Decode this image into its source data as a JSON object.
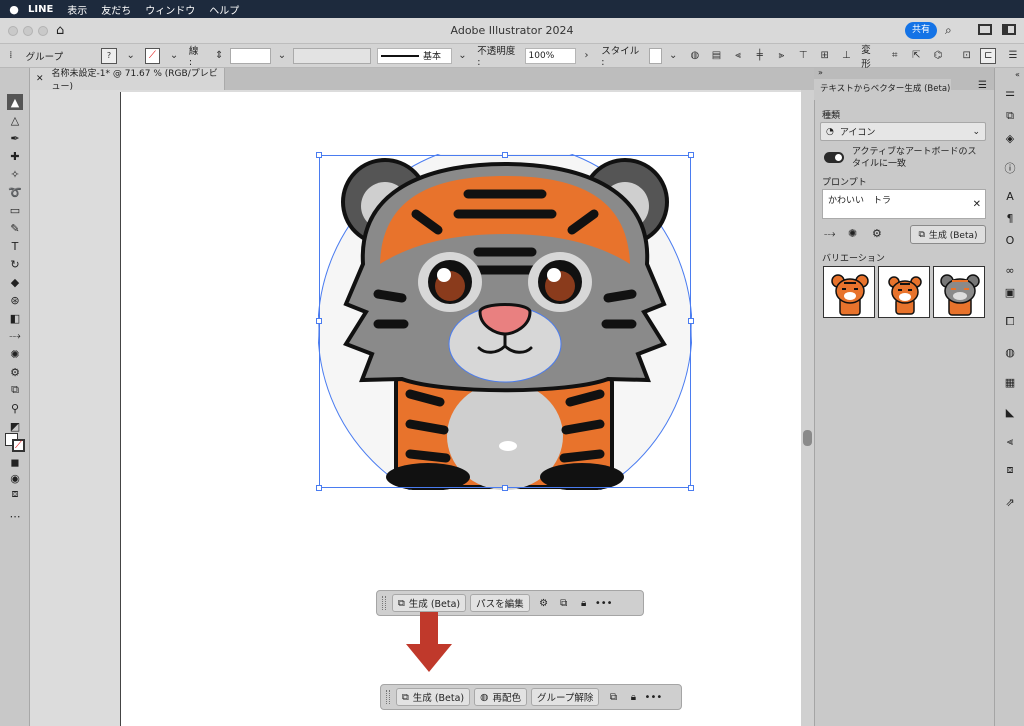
{
  "menubar": {
    "app": "LINE",
    "items": [
      "表示",
      "友だち",
      "ウィンドウ",
      "ヘルプ"
    ]
  },
  "window": {
    "title": "Adobe Illustrator 2024",
    "share_label": "共有"
  },
  "control_bar": {
    "selection_label": "グループ",
    "stroke_label": "線 :",
    "stroke_style": "基本",
    "opacity_label": "不透明度 :",
    "opacity_value": "100%",
    "style_label": "スタイル :",
    "transform_label": "変形"
  },
  "document_tab": {
    "label": "名称未設定-1* @ 71.67 % (RGB/プレビュー)"
  },
  "panel": {
    "tab_title": "テキストからベクター生成 (Beta)",
    "type_label": "種類",
    "type_value": "アイコン",
    "match_style_label_line1": "アクティブなアートボードのス",
    "match_style_label_line2": "タイルに一致",
    "prompt_label": "プロンプト",
    "prompt_value": "かわいい　トラ",
    "generate_label": "生成 (Beta)",
    "variations_label": "バリエーション"
  },
  "taskbar_top": {
    "generate_label": "生成 (Beta)",
    "edit_path_label": "パスを編集"
  },
  "taskbar_bottom": {
    "generate_label": "生成 (Beta)",
    "recolor_label": "再配色",
    "ungroup_label": "グループ解除"
  },
  "colors": {
    "accent": "#1473e6",
    "arrow": "#c0392b",
    "tiger_orange": "#e8732c",
    "selection": "#4a7cf0"
  }
}
